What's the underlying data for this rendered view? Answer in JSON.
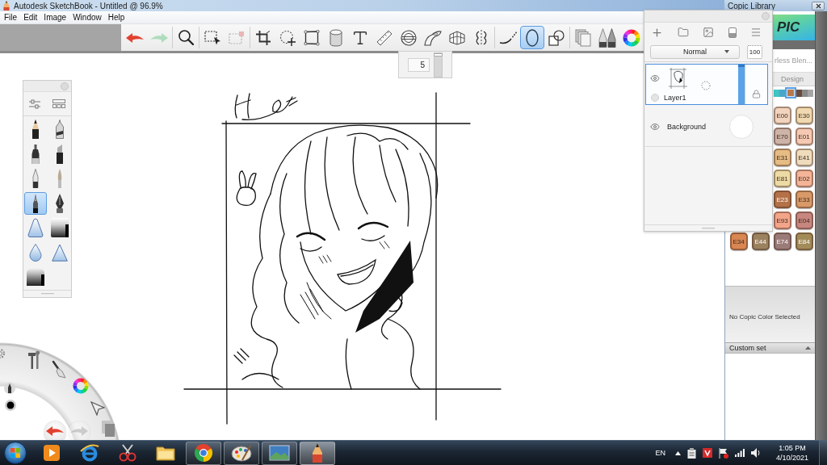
{
  "window": {
    "title": "Autodesk SketchBook - Untitled @ 96.9%"
  },
  "menu": [
    "File",
    "Edit",
    "Image",
    "Window",
    "Help"
  ],
  "toolbar": {
    "groups": [
      [
        {
          "kind": "undo",
          "selected": false,
          "disabled": false
        },
        {
          "kind": "redo",
          "selected": false,
          "disabled": true
        }
      ],
      [
        {
          "kind": "zoom",
          "selected": false,
          "disabled": false
        }
      ],
      [
        {
          "kind": "select",
          "selected": false,
          "disabled": false
        },
        {
          "kind": "deselect",
          "selected": false,
          "disabled": true
        }
      ],
      [
        {
          "kind": "crop",
          "selected": false,
          "disabled": false
        },
        {
          "kind": "transform",
          "selected": false,
          "disabled": false
        },
        {
          "kind": "distort",
          "selected": false,
          "disabled": false
        },
        {
          "kind": "fill",
          "selected": false,
          "disabled": false
        },
        {
          "kind": "text",
          "selected": false,
          "disabled": false
        },
        {
          "kind": "ruler",
          "selected": false,
          "disabled": false
        },
        {
          "kind": "ellipse-guide",
          "selected": false,
          "disabled": false
        },
        {
          "kind": "french-curve",
          "selected": false,
          "disabled": false
        },
        {
          "kind": "perspective",
          "selected": false,
          "disabled": false
        },
        {
          "kind": "symmetry",
          "selected": false,
          "disabled": false
        }
      ],
      [
        {
          "kind": "stroke",
          "selected": false,
          "disabled": false
        },
        {
          "kind": "ellipse",
          "selected": true,
          "disabled": false
        },
        {
          "kind": "shapes",
          "selected": false,
          "disabled": false
        }
      ],
      [
        {
          "kind": "copy",
          "selected": false,
          "disabled": false
        },
        {
          "kind": "brushes",
          "selected": false,
          "disabled": false
        },
        {
          "kind": "color",
          "selected": false,
          "disabled": false
        }
      ]
    ]
  },
  "brush_size": {
    "value": "5",
    "level": 0.97
  },
  "brush_palette": {
    "brushes": [
      {
        "kind": "pencil",
        "selected": false
      },
      {
        "kind": "technical-pen",
        "selected": false
      },
      {
        "kind": "marker",
        "selected": false
      },
      {
        "kind": "chisel-marker",
        "selected": false
      },
      {
        "kind": "ballpoint",
        "selected": false
      },
      {
        "kind": "paintbrush",
        "selected": false
      },
      {
        "kind": "ink-pen",
        "selected": true
      },
      {
        "kind": "nib",
        "selected": false
      },
      {
        "kind": "airbrush",
        "selected": false
      },
      {
        "kind": "eraser",
        "selected": false
      },
      {
        "kind": "droplet",
        "selected": false
      },
      {
        "kind": "triangle",
        "selected": false
      },
      {
        "kind": "block",
        "selected": false
      }
    ]
  },
  "radial_menu": {
    "buttons": [
      {
        "kind": "undo",
        "disabled": false
      },
      {
        "kind": "redo",
        "disabled": true
      }
    ]
  },
  "layers_panel": {
    "blend_mode": "Normal",
    "opacity": "100",
    "layers": [
      {
        "kind": "paint",
        "name": "Layer1",
        "selected": true,
        "visible": true,
        "level": 1
      },
      {
        "kind": "background",
        "name": "Background",
        "selected": false,
        "visible": true
      }
    ]
  },
  "copic_library": {
    "title": "Copic Library",
    "logo_text": "PIC",
    "set_name": "rless Blen...",
    "tab": "Design",
    "families": [
      {
        "color": "#40c4c4",
        "selected": false
      },
      {
        "color": "#4aa6c8",
        "selected": false
      },
      {
        "color": "#b87a4a",
        "selected": true
      },
      {
        "color": "#6b4a3a",
        "selected": false
      },
      {
        "color": "#8a8a8a",
        "selected": false
      },
      {
        "color": "#a5a5a5",
        "selected": false
      }
    ],
    "swatch_rows": [
      [
        {
          "code": "E00",
          "color": "#f2d3bd"
        },
        {
          "code": "E30",
          "color": "#f0d9b0"
        }
      ],
      [
        {
          "code": "E70",
          "color": "#cdb4a6"
        },
        {
          "code": "E01",
          "color": "#f6c9b2"
        }
      ],
      [
        {
          "code": "E31",
          "color": "#e6bb84"
        },
        {
          "code": "E41",
          "color": "#efdcbd"
        }
      ],
      [
        {
          "code": "E81",
          "color": "#eddba5"
        },
        {
          "code": "E02",
          "color": "#f4b497"
        }
      ],
      [
        {
          "code": "E23",
          "color": "#b47148"
        },
        {
          "code": "E33",
          "color": "#d99a68"
        }
      ],
      [
        {
          "code": "E93",
          "color": "#f3a58a"
        },
        {
          "code": "E04",
          "color": "#c7867f"
        }
      ],
      [
        {
          "code": "E34",
          "color": "#d98652"
        },
        {
          "code": "E44",
          "color": "#9c815f"
        },
        {
          "code": "E74",
          "color": "#9b7b78"
        },
        {
          "code": "E84",
          "color": "#a28b58"
        }
      ]
    ],
    "status": "No Copic Color Selected",
    "custom_set": "Custom set"
  },
  "taskbar": {
    "apps": [
      {
        "kind": "player",
        "running": false,
        "selected": false
      },
      {
        "kind": "ring",
        "running": false,
        "selected": false
      },
      {
        "kind": "scissors",
        "running": false,
        "selected": false
      },
      {
        "kind": "folder",
        "running": false,
        "selected": false
      },
      {
        "kind": "sectors",
        "running": true,
        "selected": false
      },
      {
        "kind": "palette",
        "running": true,
        "selected": false
      },
      {
        "kind": "picture",
        "running": true,
        "selected": false
      },
      {
        "kind": "pencil",
        "running": true,
        "selected": true
      }
    ],
    "language": "EN",
    "time": "1:05 PM",
    "date": "4/10/2021"
  }
}
